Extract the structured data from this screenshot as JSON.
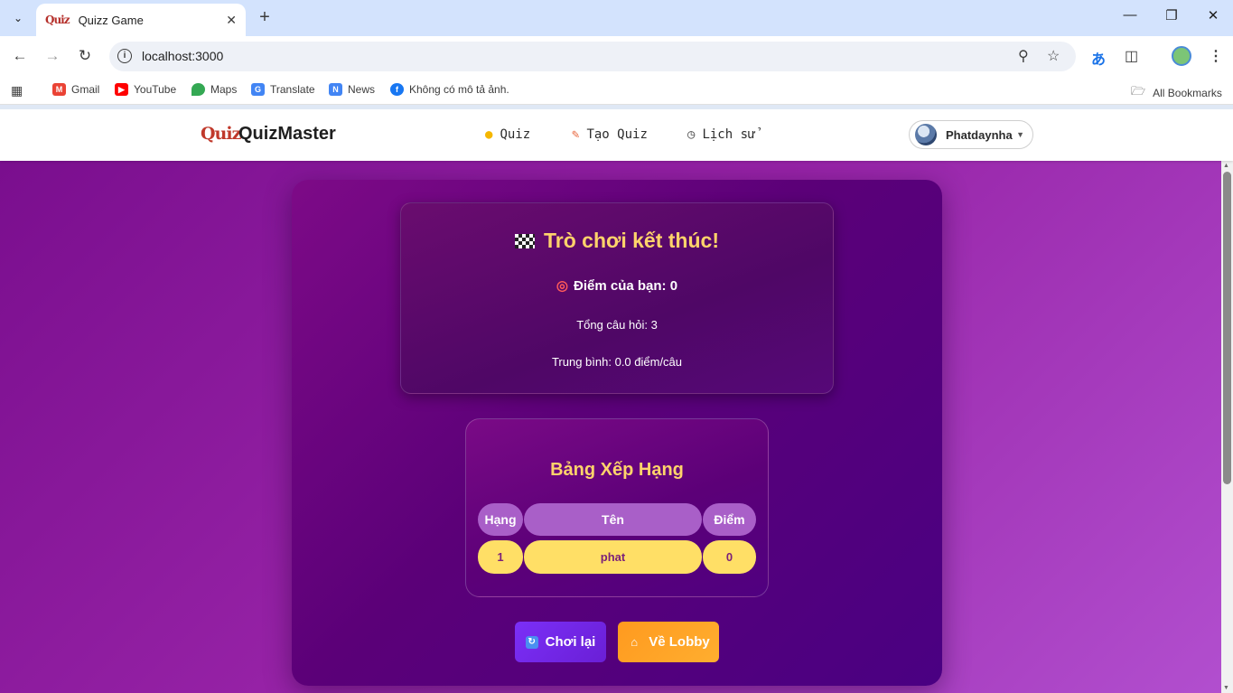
{
  "browser": {
    "tab_title": "Quizz Game",
    "tab_favicon_text": "Quiz",
    "url": "localhost:3000",
    "bookmarks": [
      {
        "label": "Gmail",
        "icon": "gmail-icon",
        "color": "#ea4335"
      },
      {
        "label": "YouTube",
        "icon": "youtube-icon",
        "color": "#ff0000"
      },
      {
        "label": "Maps",
        "icon": "maps-icon",
        "color": "#34a853"
      },
      {
        "label": "Translate",
        "icon": "translate-icon",
        "color": "#4285f4"
      },
      {
        "label": "News",
        "icon": "news-icon",
        "color": "#4285f4"
      },
      {
        "label": "Không có mô tả ảnh.",
        "icon": "facebook-icon",
        "color": "#1877f2"
      }
    ],
    "all_bookmarks": "All Bookmarks"
  },
  "header": {
    "logo_mark": "Quiz",
    "logo_text": "QuizMaster",
    "nav": [
      {
        "label": "Quiz",
        "icon": "lightbulb-icon"
      },
      {
        "label": "Tạo Quiz",
        "icon": "pencil-icon"
      },
      {
        "label": "Lịch sử",
        "icon": "clock-icon"
      }
    ],
    "user_name": "Phatdaynha"
  },
  "result": {
    "title": "Trò chơi kết thúc!",
    "score_line": "Điểm của bạn: 0",
    "total_questions": "Tổng câu hỏi: 3",
    "average": "Trung bình: 0.0 điểm/câu"
  },
  "leaderboard": {
    "title": "Bảng Xếp Hạng",
    "columns": [
      "Hạng",
      "Tên",
      "Điểm"
    ],
    "rows": [
      {
        "rank": "1",
        "name": "phat",
        "score": "0"
      }
    ]
  },
  "actions": {
    "replay_label": "Chơi lại",
    "lobby_label": "Về Lobby"
  },
  "colors": {
    "accent_gold": "#ffd36b",
    "purple_bg": "#7a0e8e",
    "row_yellow": "#ffdf66",
    "replay_btn": "#7b2ff7",
    "lobby_btn": "#ff9a1f"
  }
}
